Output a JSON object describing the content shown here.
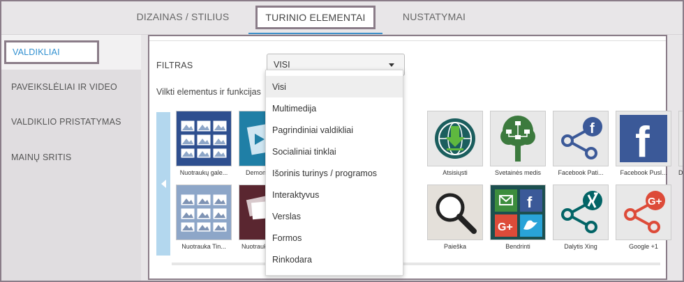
{
  "tabs": [
    {
      "label": "DIZAINAS / STILIUS"
    },
    {
      "label": "TURINIO ELEMENTAI"
    },
    {
      "label": "NUSTATYMAI"
    }
  ],
  "sidebar": {
    "items": [
      {
        "label": "VALDIKLIAI"
      },
      {
        "label": "PAVEIKSLĖLIAI IR VIDEO"
      },
      {
        "label": "VALDIKLIO PRISTATYMAS"
      },
      {
        "label": "MAINŲ SRITIS"
      }
    ]
  },
  "filter": {
    "label": "FILTRAS",
    "selected": "VISI",
    "options": [
      "Visi",
      "Multimedija",
      "Pagrindiniai valdikliai",
      "Socialiniai tinklai",
      "Išorinis turinys / programos",
      "Interaktyvus",
      "Verslas",
      "Formos",
      "Rinkodara"
    ]
  },
  "drag_text": "Vilkti elementus ir funkcijas",
  "tiles_row1": [
    {
      "caption": "Nuotraukų gale...",
      "icon": "photo-gallery-icon"
    },
    {
      "caption": "Demon",
      "icon": "demo-slideshow-icon"
    },
    {
      "caption": "",
      "icon": "video-icon"
    },
    {
      "caption": "Atsisiųsti",
      "icon": "download-globe-icon"
    },
    {
      "caption": "Svetainės medis",
      "icon": "sitemap-tree-icon"
    },
    {
      "caption": "Facebook Pati...",
      "icon": "facebook-share-icon"
    },
    {
      "caption": "Facebook Pusl...",
      "icon": "facebook-icon"
    },
    {
      "caption": "D",
      "icon": "partial-icon"
    }
  ],
  "tiles_row2": [
    {
      "caption": "Nuotrauka Tin...",
      "icon": "photo-grid-icon"
    },
    {
      "caption": "Nuotrauk",
      "icon": "photo-stack-icon"
    },
    {
      "caption": "",
      "icon": "video-red-icon"
    },
    {
      "caption": "Paieška",
      "icon": "search-icon"
    },
    {
      "caption": "Bendrinti",
      "icon": "share-social-icon"
    },
    {
      "caption": "Dalytis Xing",
      "icon": "xing-share-icon"
    },
    {
      "caption": "Google +1",
      "icon": "google-plus-share-icon"
    }
  ],
  "colors": {
    "accent": "#3b8fc9",
    "frame": "#8a7c88",
    "facebook": "#3b5998",
    "google": "#dd4b39",
    "xing": "#026466"
  }
}
